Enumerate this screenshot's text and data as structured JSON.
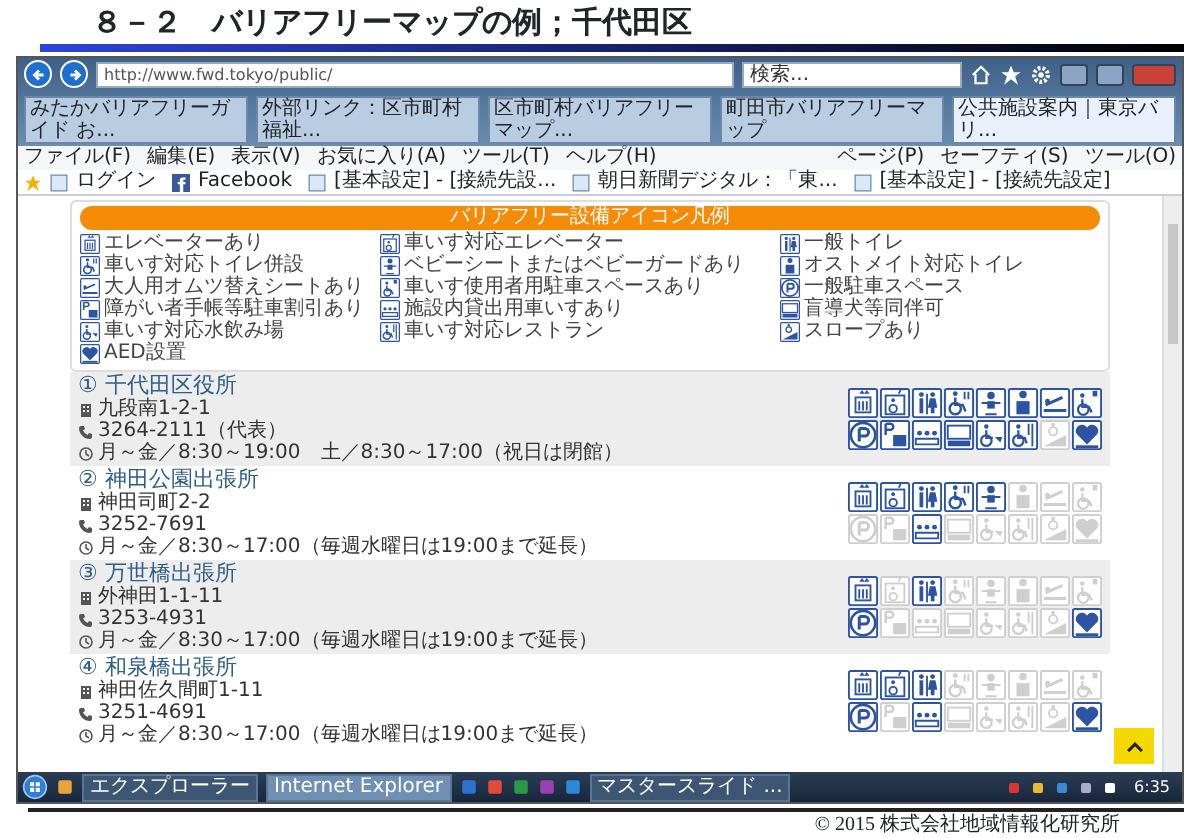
{
  "slide": {
    "title": "８－２　バリアフリーマップの例；千代田区",
    "footer": "© 2015 株式会社地域情報化研究所"
  },
  "browser": {
    "address": "http://www.fwd.tokyo/public/",
    "search": {
      "placeholder": "検索..."
    },
    "tabs": [
      {
        "label": "みたかバリアフリーガイド お...",
        "selected": false
      },
      {
        "label": "外部リンク：区市町村福祉...",
        "selected": false
      },
      {
        "label": "区市町村バリアフリーマップ...",
        "selected": false
      },
      {
        "label": "町田市バリアフリーマップ",
        "selected": false
      },
      {
        "label": "公共施設案内｜東京バリ...",
        "selected": true
      }
    ],
    "menu": [
      "ファイル(F)",
      "編集(E)",
      "表示(V)",
      "お気に入り(A)",
      "ツール(T)",
      "ヘルプ(H)"
    ],
    "favorites": [
      "ログイン",
      "Facebook",
      "[基本設定] - [接続先設...",
      "朝日新聞デジタル：「東...",
      "[基本設定] - [接続先設定]"
    ],
    "commands": [
      "ページ(P)",
      "セーフティ(S)",
      "ツール(O)"
    ]
  },
  "legend": {
    "title": "バリアフリー設備アイコン凡例",
    "items": [
      "エレベーターあり",
      "車いす対応エレベーター",
      "一般トイレ",
      "車いす対応トイレ併設",
      "ベビーシートまたはベビーガードあり",
      "オストメイト対応トイレ",
      "大人用オムツ替えシートあり",
      "車いす使用者用駐車スペースあり",
      "一般駐車スペース",
      "障がい者手帳等駐車割引あり",
      "施設内貸出用車いすあり",
      "盲導犬等同伴可",
      "車いす対応水飲み場",
      "車いす対応レストラン",
      "スロープあり",
      "AED設置"
    ]
  },
  "facilities": [
    {
      "name": "① 千代田区役所",
      "address": "九段南1-2-1",
      "phone": "3264-2111（代表）",
      "hours": "月～金／8:30～19:00　土／8:30～17:00（祝日は閉館）",
      "amenities": [
        {
          "available": true
        },
        {
          "available": true
        },
        {
          "available": true
        },
        {
          "available": true
        },
        {
          "available": true
        },
        {
          "available": true
        },
        {
          "available": true
        },
        {
          "available": true
        },
        {
          "available": true
        },
        {
          "available": true
        },
        {
          "available": true
        },
        {
          "available": true
        },
        {
          "available": true
        },
        {
          "available": true
        },
        {
          "available": false
        },
        {
          "available": true
        }
      ]
    },
    {
      "name": "② 神田公園出張所",
      "address": "神田司町2-2",
      "phone": "3252-7691",
      "hours": "月～金／8:30～17:00（毎週水曜日は19:00まで延長）",
      "amenities": [
        {
          "available": true
        },
        {
          "available": true
        },
        {
          "available": true
        },
        {
          "available": true
        },
        {
          "available": true
        },
        {
          "available": false
        },
        {
          "available": false
        },
        {
          "available": false
        },
        {
          "available": false
        },
        {
          "available": false
        },
        {
          "available": true
        },
        {
          "available": false
        },
        {
          "available": false
        },
        {
          "available": false
        },
        {
          "available": false
        },
        {
          "available": false
        }
      ]
    },
    {
      "name": "③ 万世橋出張所",
      "address": "外神田1-1-11",
      "phone": "3253-4931",
      "hours": "月～金／8:30～17:00（毎週水曜日は19:00まで延長）",
      "amenities": [
        {
          "available": true
        },
        {
          "available": false
        },
        {
          "available": true
        },
        {
          "available": false
        },
        {
          "available": false
        },
        {
          "available": false
        },
        {
          "available": false
        },
        {
          "available": false
        },
        {
          "available": true
        },
        {
          "available": false
        },
        {
          "available": false
        },
        {
          "available": false
        },
        {
          "available": false
        },
        {
          "available": false
        },
        {
          "available": false
        },
        {
          "available": true
        }
      ]
    },
    {
      "name": "④ 和泉橋出張所",
      "address": "神田佐久間町1-11",
      "phone": "3251-4691",
      "hours": "月～金／8:30～17:00（毎週水曜日は19:00まで延長）",
      "amenities": [
        {
          "available": true
        },
        {
          "available": true
        },
        {
          "available": true
        },
        {
          "available": false
        },
        {
          "available": false
        },
        {
          "available": false
        },
        {
          "available": false
        },
        {
          "available": false
        },
        {
          "available": true
        },
        {
          "available": false
        },
        {
          "available": true
        },
        {
          "available": false
        },
        {
          "available": false
        },
        {
          "available": false
        },
        {
          "available": false
        },
        {
          "available": true
        }
      ]
    }
  ],
  "taskbar": {
    "items": [
      {
        "label": "エクスプローラー",
        "selected": false
      },
      {
        "label": "Internet Explorer",
        "selected": true
      },
      {
        "label": "マスタースライド ...",
        "selected": false
      }
    ],
    "clock": "6:35"
  }
}
